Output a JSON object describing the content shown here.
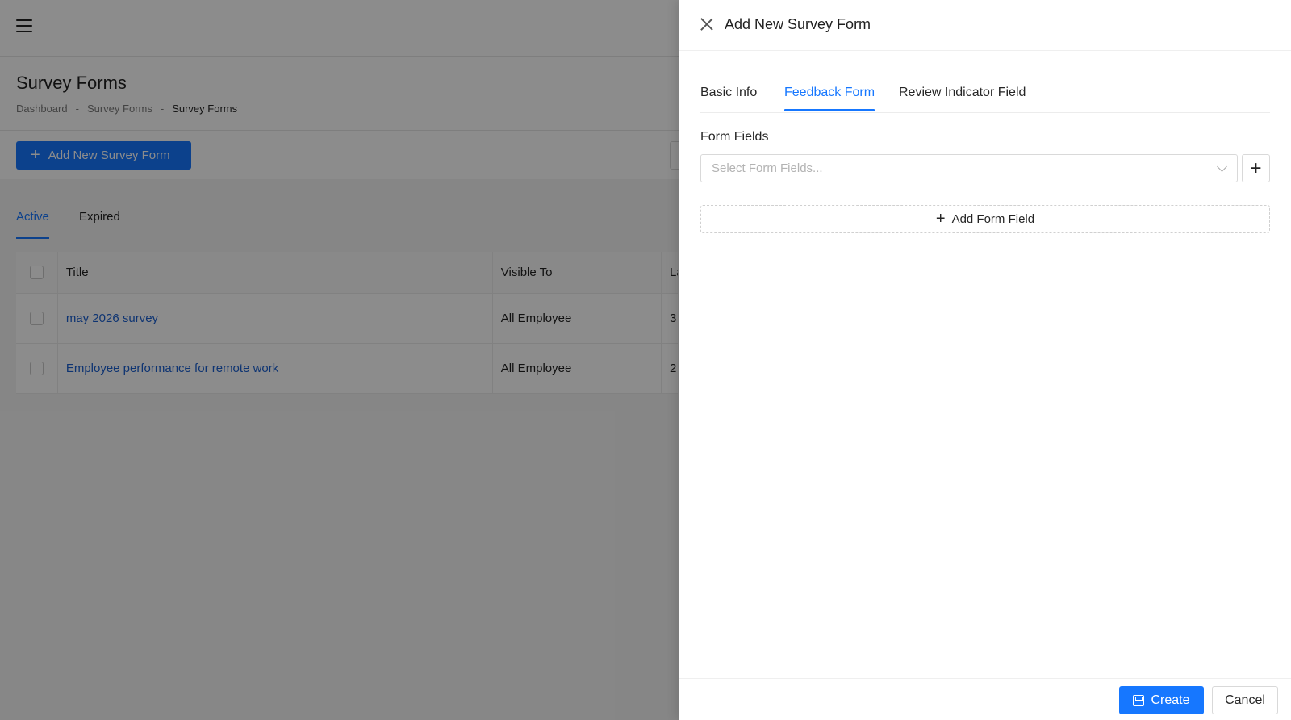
{
  "page": {
    "title": "Survey Forms",
    "breadcrumb": [
      "Dashboard",
      "-",
      "Survey Forms",
      "-",
      "Survey Forms"
    ],
    "add_button_label": "Add New Survey Form",
    "tabs": [
      {
        "label": "Active",
        "active": true
      },
      {
        "label": "Expired",
        "active": false
      }
    ],
    "table": {
      "columns": [
        "Title",
        "Visible To",
        "La"
      ],
      "rows": [
        {
          "title": "may 2026 survey",
          "visible_to": "All Employee",
          "last": "3"
        },
        {
          "title": "Employee performance for remote work",
          "visible_to": "All Employee",
          "last": "2"
        }
      ]
    }
  },
  "drawer": {
    "title": "Add New Survey Form",
    "tabs": [
      {
        "label": "Basic Info",
        "active": false
      },
      {
        "label": "Feedback Form",
        "active": true
      },
      {
        "label": "Review Indicator Field",
        "active": false
      }
    ],
    "form_fields_label": "Form Fields",
    "select_placeholder": "Select Form Fields...",
    "add_field_label": "Add Form Field",
    "create_label": "Create",
    "cancel_label": "Cancel"
  },
  "colors": {
    "accent": "#1677ff",
    "link": "#1a5fd0",
    "overlay": "rgba(0,0,0,0.45)"
  },
  "icons": [
    "hamburger-icon",
    "plus-icon",
    "close-icon",
    "chevron-down-icon",
    "save-icon"
  ]
}
